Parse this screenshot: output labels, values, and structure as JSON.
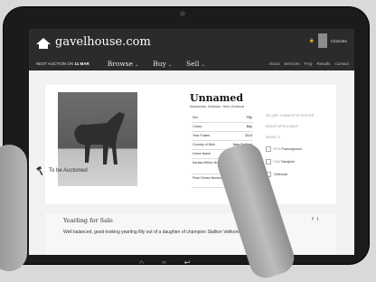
{
  "header": {
    "logo_text": "gavelhouse.com",
    "user_name": "Charlotte",
    "auction_label": "NEXT AUCTION ON",
    "auction_date": "11 MAR",
    "menu": [
      {
        "label": "Browse"
      },
      {
        "label": "Buy"
      },
      {
        "label": "Sell"
      }
    ],
    "links": [
      "About",
      "Services",
      "FAQ",
      "Results",
      "Contact"
    ]
  },
  "listing": {
    "name": "Unnamed",
    "location": "Matamata, Waikato, New Zealand",
    "status_label": "To be Auctioned",
    "details": [
      {
        "label": "Sex",
        "value": "Filly"
      },
      {
        "label": "Colour",
        "value": "Bay"
      },
      {
        "label": "Year Foaled",
        "value": "2014"
      },
      {
        "label": "Country of Birth",
        "value": "New Zealand"
      },
      {
        "label": "Horse Name",
        "value": "Unnamed"
      },
      {
        "label": "Karaka Million Nominated",
        "value": ""
      },
      {
        "label": "Pearl Series Nominated",
        "value": ""
      }
    ],
    "side": {
      "seller": "SELLER: CHARLOTTE PORTER",
      "location": "MOOST APPLICABLE",
      "header": "VIEWS: 0",
      "items": [
        {
          "tag": "SIRE",
          "name": "Prancegmoon"
        },
        {
          "tag": "DAM",
          "name": "Sandpink"
        },
        {
          "tag": "",
          "name": "Vellkorad"
        }
      ]
    }
  },
  "sale": {
    "title": "Yearling for Sale",
    "description": "Well balanced, good-looking yearling filly out of a daughter of champion Stallion Veilkoread."
  }
}
